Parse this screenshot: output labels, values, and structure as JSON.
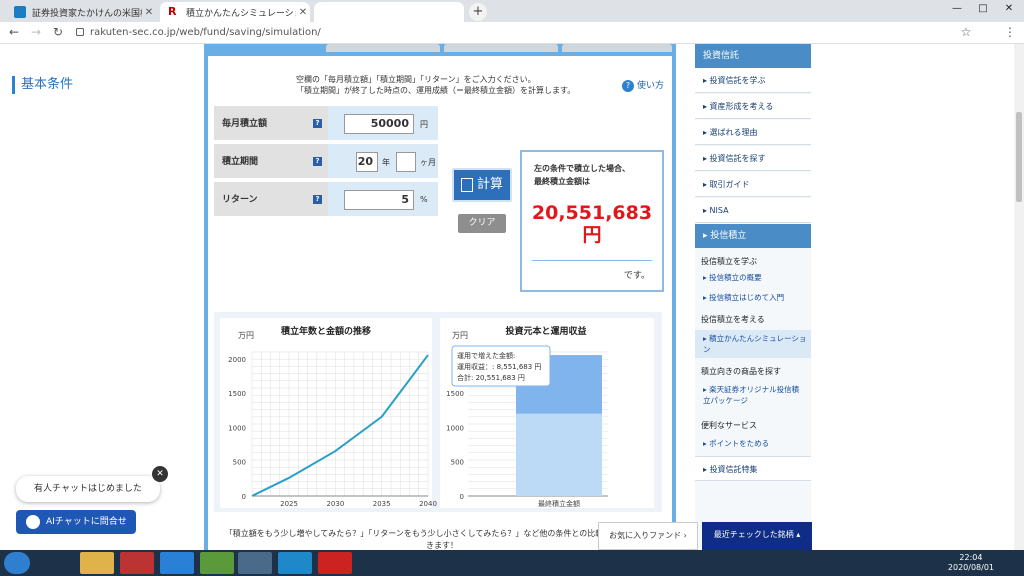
{
  "browser": {
    "tabs": [
      {
        "title": "証券投資家たかけんの米国株ク",
        "active": false
      },
      {
        "title": "積立かんたんシミュレーション",
        "active": true
      }
    ],
    "url": "rakuten-sec.co.jp/web/fund/saving/simulation/"
  },
  "form": {
    "section_title": "基本条件",
    "desc_line1": "空欄の「毎月積立額」「積立期間」「リターン」をご入力ください。",
    "desc_line2": "「積立期間」が終了した時点の、運用成績（＝最終積立金額）を計算します。",
    "howto": "使い方",
    "monthly_label": "毎月積立額",
    "monthly_value": "50000",
    "monthly_unit": "円",
    "period_label": "積立期間",
    "period_years": "20",
    "period_years_unit": "年",
    "period_months": "",
    "period_months_unit": "ヶ月",
    "return_label": "リターン",
    "return_value": "5",
    "return_unit": "%",
    "calc_button": "計算",
    "clear_button": "クリア"
  },
  "result": {
    "caption_line1": "左の条件で積立した場合、",
    "caption_line2": "最終積立金額は",
    "amount": "20,551,683",
    "yen": "円",
    "desu": "です。"
  },
  "chart_data": [
    {
      "type": "line",
      "title": "積立年数と金額の推移",
      "ylabel": "万円",
      "x": [
        2021,
        2025,
        2030,
        2035,
        2040
      ],
      "series": [
        {
          "values": [
            0,
            265,
            655,
            1155,
            2055
          ]
        }
      ],
      "xticks": [
        2025,
        2030,
        2035,
        2040
      ],
      "yticks": [
        0,
        500,
        1000,
        1500,
        2000
      ],
      "ylim": [
        0,
        2100
      ]
    },
    {
      "type": "bar",
      "title": "投資元本と運用収益",
      "ylabel": "万円",
      "categories": [
        "最終積立金額"
      ],
      "series": [
        {
          "name": "投資元本",
          "values": [
            1200
          ]
        },
        {
          "name": "運用収益",
          "values": [
            855
          ]
        }
      ],
      "yticks": [
        0,
        500,
        1000,
        1500
      ],
      "ylim": [
        0,
        2100
      ],
      "tooltip": {
        "line1": "運用で増えた金額:",
        "line2": "運用収益：: 8,551,683 円",
        "line3": "合計: 20,551,683 円"
      }
    }
  ],
  "note": "「積立額をもう少し増やしてみたら？」「リターンをもう少し小さくしてみたら？」など他の条件との比較がカンタンにできます！",
  "sidebar": {
    "header": "投資信託",
    "items": [
      "投資信託を学ぶ",
      "資産形成を考える",
      "選ばれる理由",
      "投資信託を探す",
      "取引ガイド",
      "NISA"
    ],
    "sub_header": "投信積立",
    "groups": [
      {
        "title": "投信積立を学ぶ",
        "links": [
          "投信積立の概要",
          "投信積立はじめて入門"
        ]
      },
      {
        "title": "投信積立を考える",
        "links": [
          "積立かんたんシミュレーション"
        ]
      },
      {
        "title": "積立向きの商品を探す",
        "links": [
          "楽天証券オリジナル投信積立パッケージ"
        ]
      },
      {
        "title": "便利なサービス",
        "links": [
          "ポイントをためる"
        ]
      }
    ],
    "last": "投資信託特集"
  },
  "footer": {
    "fav_fund": "お気に入りファンド",
    "recent": "最近チェックした銘柄",
    "chat_bubble": "有人チャットはじめました",
    "ai_chat": "AIチャットに問合せ"
  },
  "taskbar": {
    "time": "22:04",
    "date": "2020/08/01"
  }
}
